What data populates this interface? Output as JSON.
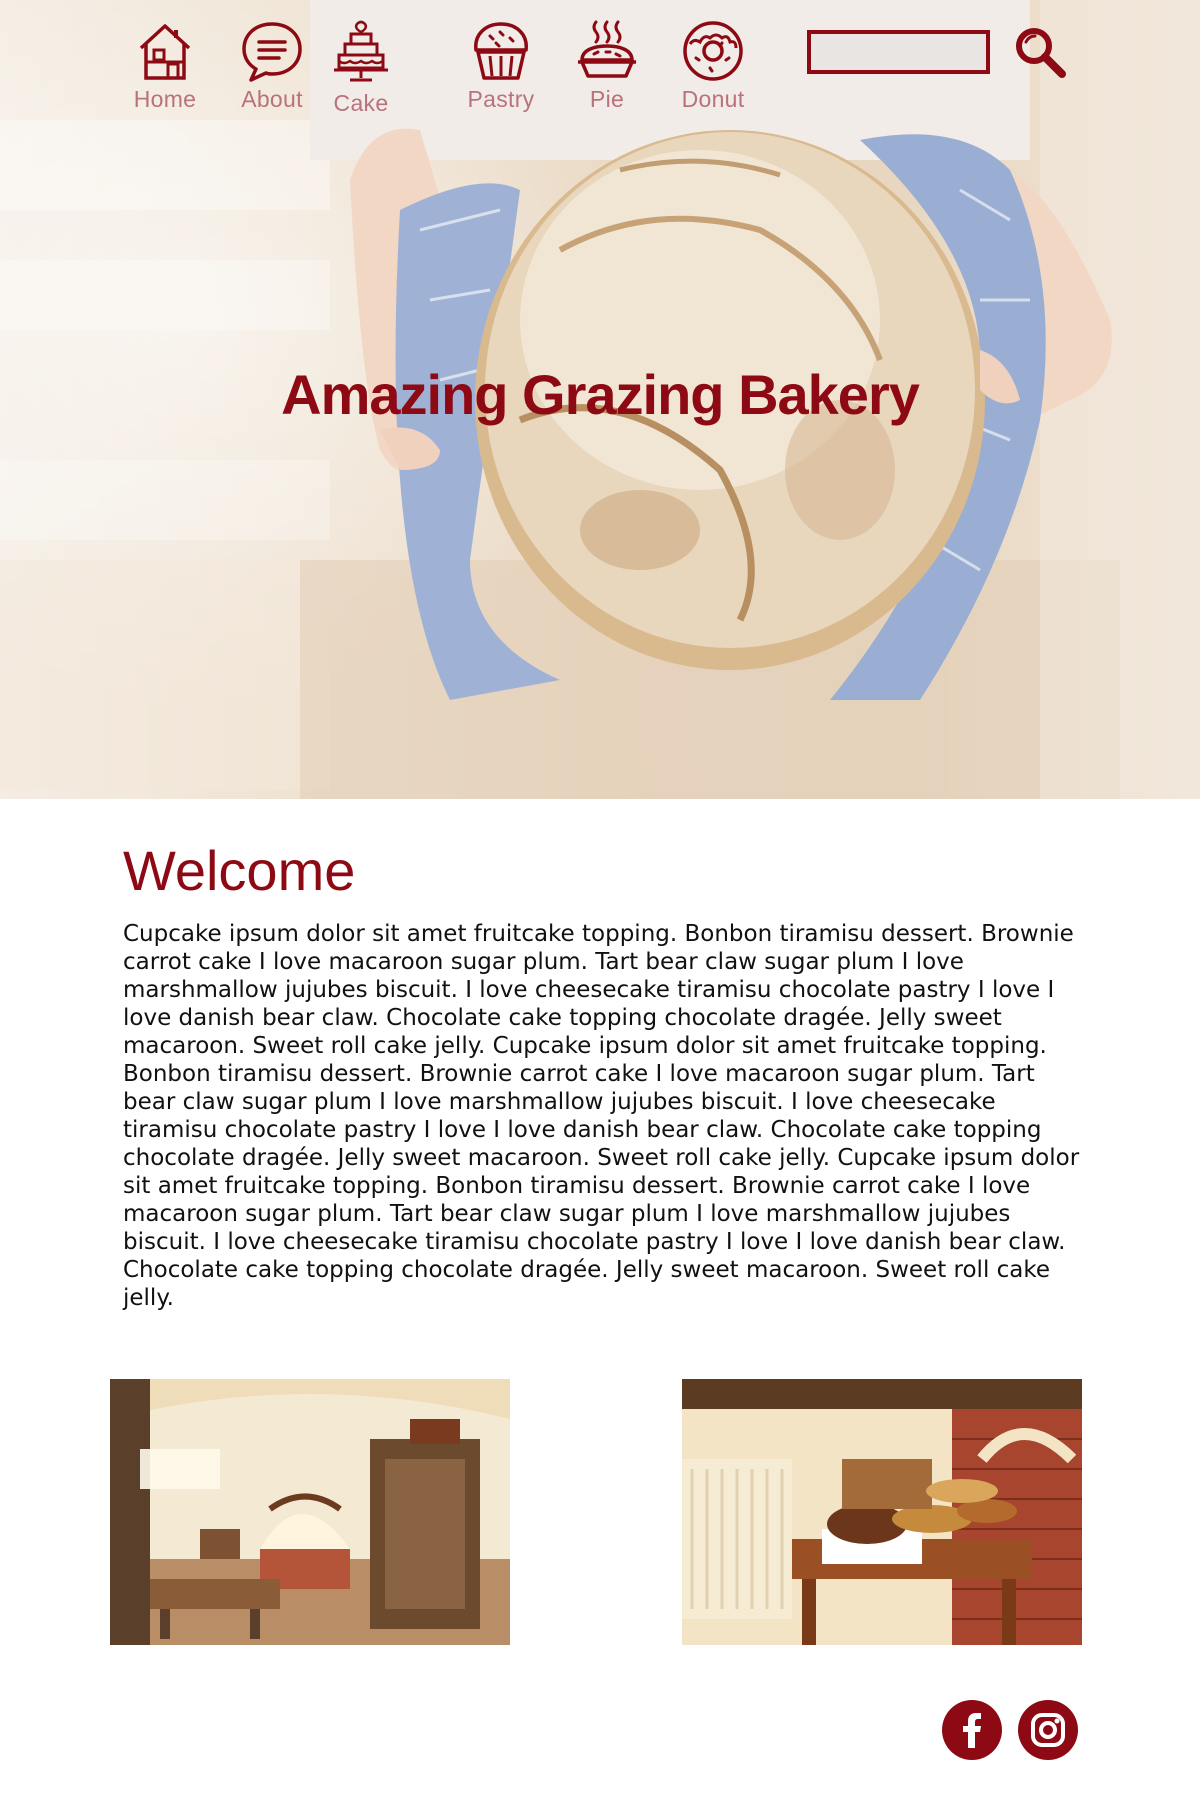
{
  "brand": {
    "title": "Amazing Grazing Bakery",
    "accent_color": "#8d0a14",
    "nav_label_color": "#b9727a"
  },
  "nav": {
    "items": [
      {
        "label": "Home",
        "icon": "house-icon"
      },
      {
        "label": "About",
        "icon": "chat-bubble-icon"
      },
      {
        "label": "Cake",
        "icon": "tiered-cake-icon"
      },
      {
        "label": "Pastry",
        "icon": "muffin-icon"
      },
      {
        "label": "Pie",
        "icon": "steaming-pie-icon"
      },
      {
        "label": "Donut",
        "icon": "donut-icon"
      }
    ],
    "search": {
      "value": "",
      "icon": "search-icon"
    }
  },
  "hero": {
    "image": "hands-holding-bread-loaf-in-blue-towel"
  },
  "main": {
    "heading": "Welcome",
    "paragraph": "Cupcake ipsum dolor sit amet fruitcake topping. Bonbon tiramisu dessert. Brownie carrot cake I love macaroon sugar plum. Tart bear claw sugar plum I love marshmallow jujubes biscuit. I love cheesecake tiramisu chocolate pastry I love I love danish bear claw. Chocolate cake topping chocolate dragée. Jelly sweet macaroon. Sweet roll cake jelly.  Cupcake ipsum dolor sit amet fruitcake topping. Bonbon tiramisu dessert. Brownie carrot cake I love macaroon sugar plum. Tart bear claw sugar plum I love marshmallow jujubes biscuit. I love cheesecake tiramisu chocolate pastry I love I love danish bear claw. Chocolate cake topping chocolate dragée. Jelly sweet macaroon. Sweet roll cake jelly. Cupcake ipsum dolor sit amet fruitcake topping. Bonbon tiramisu dessert. Brownie carrot cake I love macaroon sugar plum. Tart bear claw sugar plum I love marshmallow jujubes biscuit. I love cheesecake tiramisu chocolate pastry I love I love danish bear claw. Chocolate cake topping chocolate dragée. Jelly sweet macaroon. Sweet roll cake jelly.",
    "photos": [
      {
        "image": "rustic-bakery-interior-with-brick-oven"
      },
      {
        "image": "bread-on-wooden-table-beside-brick-oven"
      }
    ]
  },
  "footer": {
    "social": [
      {
        "icon": "facebook-icon"
      },
      {
        "icon": "instagram-icon"
      }
    ]
  }
}
